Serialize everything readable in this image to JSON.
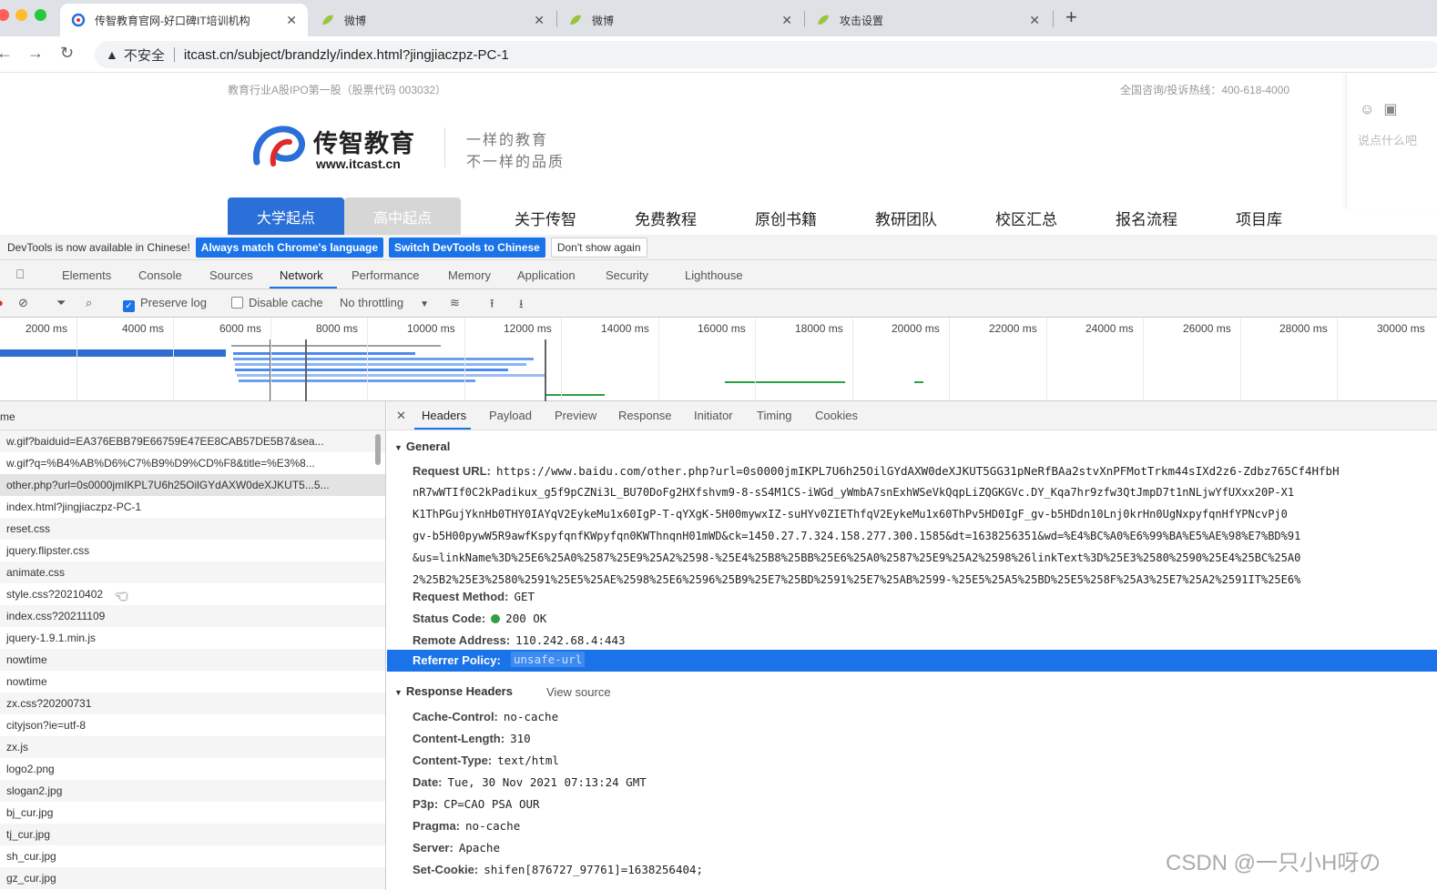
{
  "browser": {
    "tabs": [
      {
        "title": "传智教育官网-好口碑IT培训机构",
        "active": true
      },
      {
        "title": "微博",
        "active": false
      },
      {
        "title": "微博",
        "active": false
      },
      {
        "title": "攻击设置",
        "active": false
      }
    ],
    "new_tab": "+",
    "address": {
      "insecure_label": "不安全",
      "url": "itcast.cn/subject/brandzly/index.html?jingjiaczpz-PC-1"
    }
  },
  "site": {
    "top_left": "教育行业A股IPO第一股（股票代码 003032）",
    "top_right": "全国咨询/投诉热线：400-618-4000",
    "logo_cn": "传智教育",
    "logo_en": "www.itcast.cn",
    "slogan_line1": "一样的教育",
    "slogan_line2": "不一样的品质",
    "tab_active": "大学起点",
    "tab_inactive": "高中起点",
    "nav": [
      "关于传智",
      "免费教程",
      "原创书籍",
      "教研团队",
      "校区汇总",
      "报名流程",
      "项目库"
    ],
    "side_hint": "说点什么吧"
  },
  "devtools": {
    "banner": {
      "info": "DevTools is now available in Chinese!",
      "btn_match": "Always match Chrome's language",
      "btn_switch": "Switch DevTools to Chinese",
      "btn_dismiss": "Don't show again"
    },
    "tabs": [
      "Elements",
      "Console",
      "Sources",
      "Network",
      "Performance",
      "Memory",
      "Application",
      "Security",
      "Lighthouse"
    ],
    "selected_tab": "Network",
    "toolbar": {
      "preserve_log": "Preserve log",
      "disable_cache": "Disable cache",
      "throttling": "No throttling"
    },
    "timeline_ticks": [
      "2000 ms",
      "4000 ms",
      "6000 ms",
      "8000 ms",
      "10000 ms",
      "12000 ms",
      "14000 ms",
      "16000 ms",
      "18000 ms",
      "20000 ms",
      "22000 ms",
      "24000 ms",
      "26000 ms",
      "28000 ms",
      "30000 ms"
    ],
    "list_header": "me",
    "requests": [
      "w.gif?baiduid=EA376EBB79E66759E47EE8CAB57DE5B7&sea...",
      "w.gif?q=%B4%AB%D6%C7%B9%D9%CD%F8&title=%E3%8...",
      "other.php?url=0s0000jmIKPL7U6h25OilGYdAXW0deXJKUT5...5...",
      "index.html?jingjiaczpz-PC-1",
      "reset.css",
      "jquery.flipster.css",
      "animate.css",
      "style.css?20210402",
      "index.css?20211109",
      "jquery-1.9.1.min.js",
      "nowtime",
      "nowtime",
      "zx.css?20200731",
      "cityjson?ie=utf-8",
      "zx.js",
      "logo2.png",
      "slogan2.jpg",
      "bj_cur.jpg",
      "tj_cur.jpg",
      "sh_cur.jpg",
      "gz_cur.jpg"
    ],
    "detail_tabs": [
      "Headers",
      "Payload",
      "Preview",
      "Response",
      "Initiator",
      "Timing",
      "Cookies"
    ],
    "general": {
      "title": "General",
      "request_url_label": "Request URL:",
      "request_url_lines": [
        "https://www.baidu.com/other.php?url=0s0000jmIKPL7U6h25OilGYdAXW0deXJKUT5GG31pNeRfBAa2stvXnPFMotTrkm44sIXd2z6-Zdbz765Cf4HfbH",
        "nR7wWTIf0C2kPadikux_g5f9pCZNi3L_BU70DoFg2HXfshvm9-8-sS4M1CS-iWGd_yWmbA7snExhWSeVkQqpLiZQGKGVc.DY_Kqa7hr9zfw3QtJmpD7t1nNLjwYfUXxx20P-X1",
        "K1ThPGujYknHb0THY0IAYqV2EykeMu1x60IgP-T-qYXgK-5H00mywxIZ-suHYv0ZIEThfqV2EykeMu1x60ThPv5HD0IgF_gv-b5HDdn10Lnj0krHn0UgNxpyfqnHfYPNcvPj0",
        "gv-b5H00pywW5R9awfKspyfqnfKWpyfqn0KWThnqnH01mWD&ck=1450.27.7.324.158.277.300.1585&dt=1638256351&wd=%E4%BC%A0%E6%99%BA%E5%AE%98%E7%BD%91",
        "&us=linkName%3D%25E6%25A0%2587%25E9%25A2%2598-%25E4%25B8%25BB%25E6%25A0%2587%25E9%25A2%2598%26linkText%3D%25E3%2580%2590%25E4%25BC%25A0",
        "2%25B2%25E3%2580%2591%25E5%25AE%2598%25E6%2596%25B9%25E7%25BD%2591%25E7%25AB%2599-%25E5%25A5%25BD%25E5%258F%25A3%25E7%25A2%2591IT%25E6%"
      ],
      "request_method_label": "Request Method:",
      "request_method": "GET",
      "status_code_label": "Status Code:",
      "status_code": "200 OK",
      "remote_address_label": "Remote Address:",
      "remote_address": "110.242.68.4:443",
      "referrer_policy_label": "Referrer Policy:",
      "referrer_policy": "unsafe-url"
    },
    "response_headers": {
      "title": "Response Headers",
      "view_source": "View source",
      "items": [
        {
          "k": "Cache-Control:",
          "v": "no-cache"
        },
        {
          "k": "Content-Length:",
          "v": "310"
        },
        {
          "k": "Content-Type:",
          "v": "text/html"
        },
        {
          "k": "Date:",
          "v": "Tue, 30 Nov 2021 07:13:24 GMT"
        },
        {
          "k": "P3p:",
          "v": "CP=CAO PSA OUR"
        },
        {
          "k": "Pragma:",
          "v": "no-cache"
        },
        {
          "k": "Server:",
          "v": "Apache"
        },
        {
          "k": "Set-Cookie:",
          "v": "shifen[876727_97761]=1638256404;"
        }
      ]
    }
  },
  "watermark": "CSDN @一只小H呀の",
  "colors": {
    "accent": "#1a73e8",
    "site_blue": "#2b6fd8",
    "status_green": "#2ea043"
  }
}
